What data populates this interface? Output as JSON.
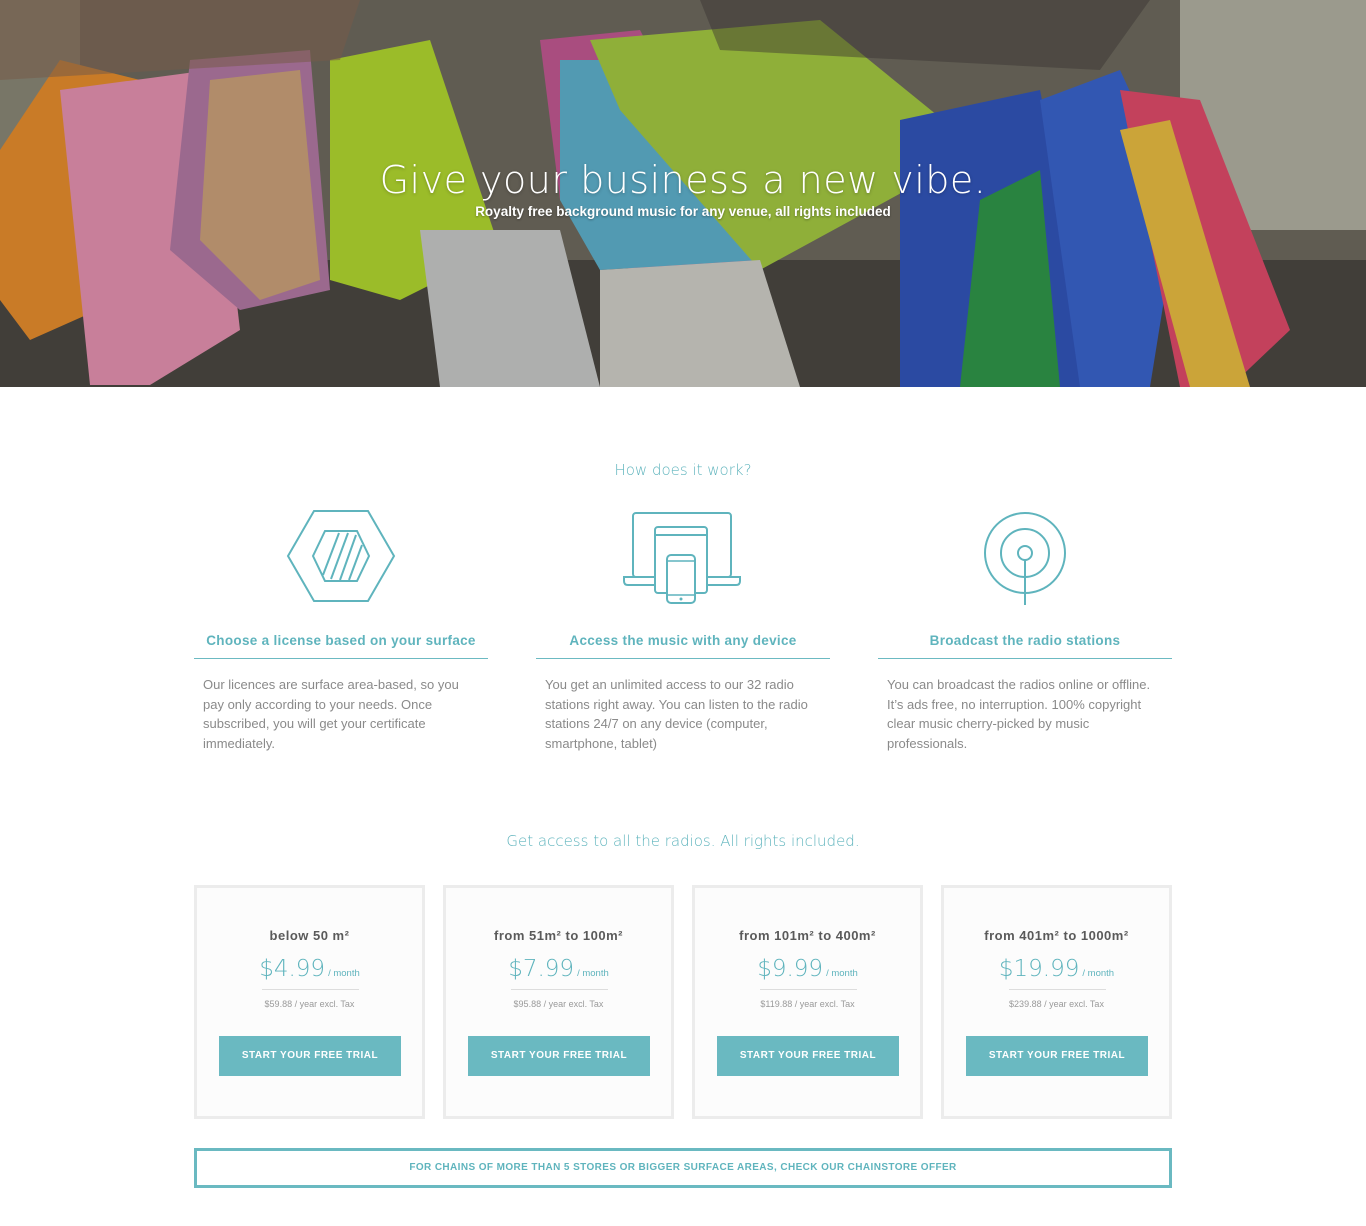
{
  "hero": {
    "title": "Give your business a new vibe.",
    "subtitle": "Royalty free background music for any venue, all rights included"
  },
  "how": {
    "title": "How does it work?",
    "features": [
      {
        "icon": "hexagon-icon",
        "title": "Choose a license based on your surface",
        "description": "Our licences are surface area-based, so you pay only according to your needs. Once subscribed, you will get your certificate immediately."
      },
      {
        "icon": "devices-icon",
        "title": "Access the music with any device",
        "description": "You get an unlimited access to our 32 radio stations right away. You can listen to the radio stations 24/7 on any device (computer, smartphone, tablet)"
      },
      {
        "icon": "broadcast-icon",
        "title": "Broadcast the radio stations",
        "description": "You can broadcast the radios online or offline. It’s ads free, no interruption. 100% copyright clear music cherry-picked by music professionals."
      }
    ]
  },
  "pricing": {
    "title": "Get access to all the radios. All rights included.",
    "plans": [
      {
        "range": "below 50 m²",
        "price": "$4.99",
        "period": "/ month",
        "yearly": "$59.88 / year excl. Tax",
        "cta": "START YOUR FREE TRIAL"
      },
      {
        "range": "from 51m² to 100m²",
        "price": "$7.99",
        "period": "/ month",
        "yearly": "$95.88 / year excl. Tax",
        "cta": "START YOUR FREE TRIAL"
      },
      {
        "range": "from 101m² to 400m²",
        "price": "$9.99",
        "period": "/ month",
        "yearly": "$119.88 / year excl. Tax",
        "cta": "START YOUR FREE TRIAL"
      },
      {
        "range": "from 401m² to 1000m²",
        "price": "$19.99",
        "period": "/ month",
        "yearly": "$239.88 / year excl. Tax",
        "cta": "START YOUR FREE TRIAL"
      }
    ],
    "chain_offer": "FOR CHAINS OF MORE THAN 5 STORES OR BIGGER SURFACE AREAS, CHECK OUR CHAINSTORE OFFER"
  },
  "colors": {
    "accent": "#5fb4bd",
    "button": "#6ab9c1",
    "card_border": "#ececec"
  }
}
